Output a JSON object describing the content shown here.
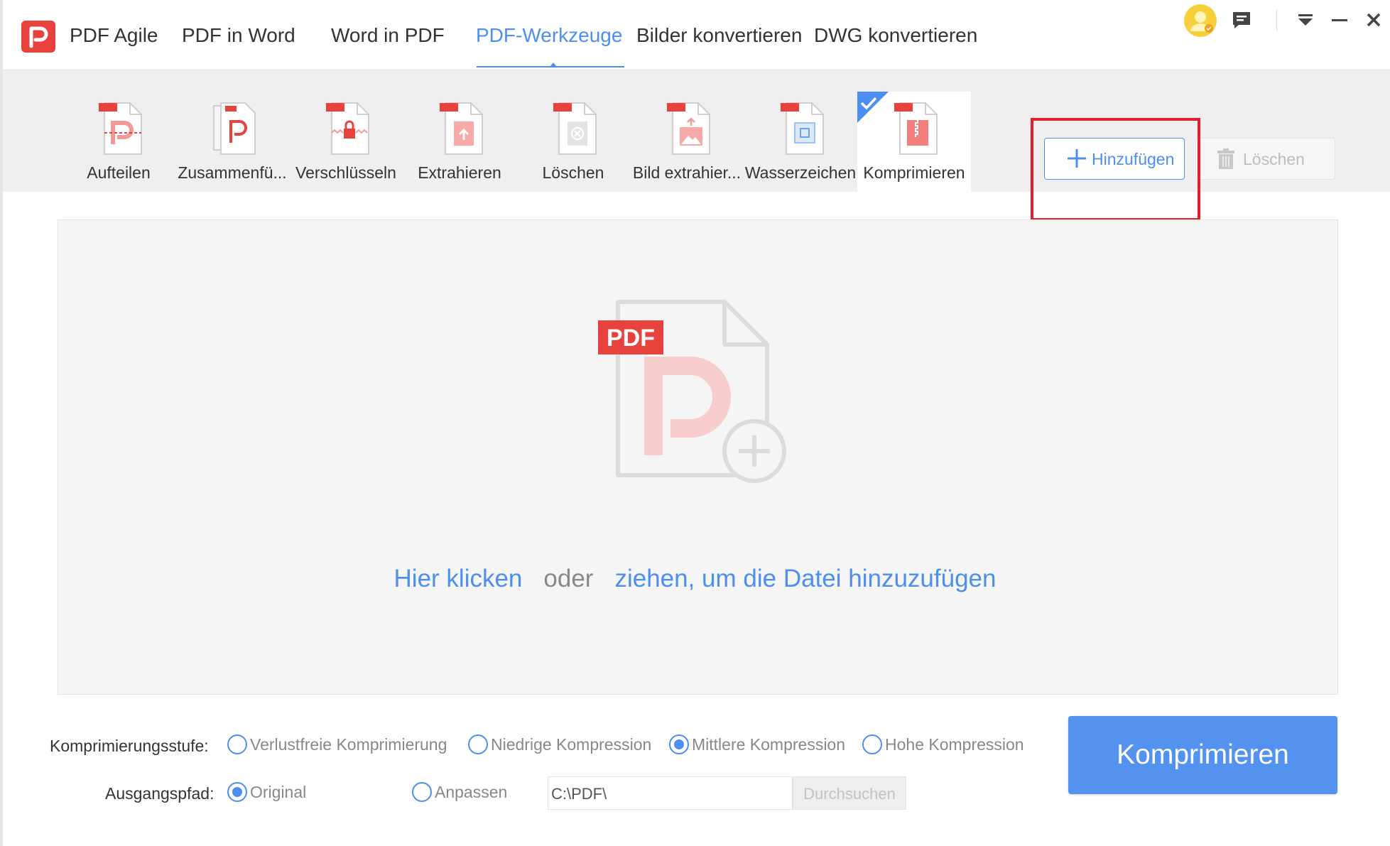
{
  "header": {
    "app_name": "PDF Agile",
    "tabs": [
      {
        "label": "PDF in Word"
      },
      {
        "label": "Word in PDF"
      },
      {
        "label": "PDF-Werkzeuge"
      },
      {
        "label": "Bilder konvertieren"
      },
      {
        "label": "DWG konvertieren"
      }
    ],
    "active_tab": "PDF-Werkzeuge"
  },
  "toolbar": {
    "tools": [
      {
        "label": "Aufteilen",
        "icon": "split-pdf-icon"
      },
      {
        "label": "Zusammenfü...",
        "icon": "merge-pdf-icon"
      },
      {
        "label": "Verschlüsseln",
        "icon": "encrypt-pdf-icon"
      },
      {
        "label": "Extrahieren",
        "icon": "extract-pdf-icon"
      },
      {
        "label": "Löschen",
        "icon": "delete-pages-icon"
      },
      {
        "label": "Bild extrahier...",
        "icon": "extract-image-icon"
      },
      {
        "label": "Wasserzeichen",
        "icon": "watermark-icon"
      },
      {
        "label": "Komprimieren",
        "icon": "compress-pdf-icon"
      }
    ],
    "active_tool": "Komprimieren",
    "add_label": "Hinzufügen",
    "delete_label": "Löschen"
  },
  "dropzone": {
    "badge": "PDF",
    "click_text": "Hier klicken",
    "or_text": "oder",
    "drag_text": "ziehen, um die Datei hinzuzufügen"
  },
  "options": {
    "level_label": "Komprimierungsstufe:",
    "levels": [
      {
        "label": "Verlustfreie Komprimierung",
        "selected": false
      },
      {
        "label": "Niedrige Kompression",
        "selected": false
      },
      {
        "label": "Mittlere Kompression",
        "selected": true
      },
      {
        "label": "Hohe Kompression",
        "selected": false
      }
    ],
    "output_label": "Ausgangspfad:",
    "output_original": "Original",
    "output_custom": "Anpassen",
    "output_selected": "Original",
    "path_value": "C:\\PDF\\",
    "browse_label": "Durchsuchen"
  },
  "action": {
    "compress_label": "Komprimieren"
  },
  "colors": {
    "accent": "#4d8ff0",
    "brand_red": "#e8423c",
    "highlight": "#e0202a"
  }
}
